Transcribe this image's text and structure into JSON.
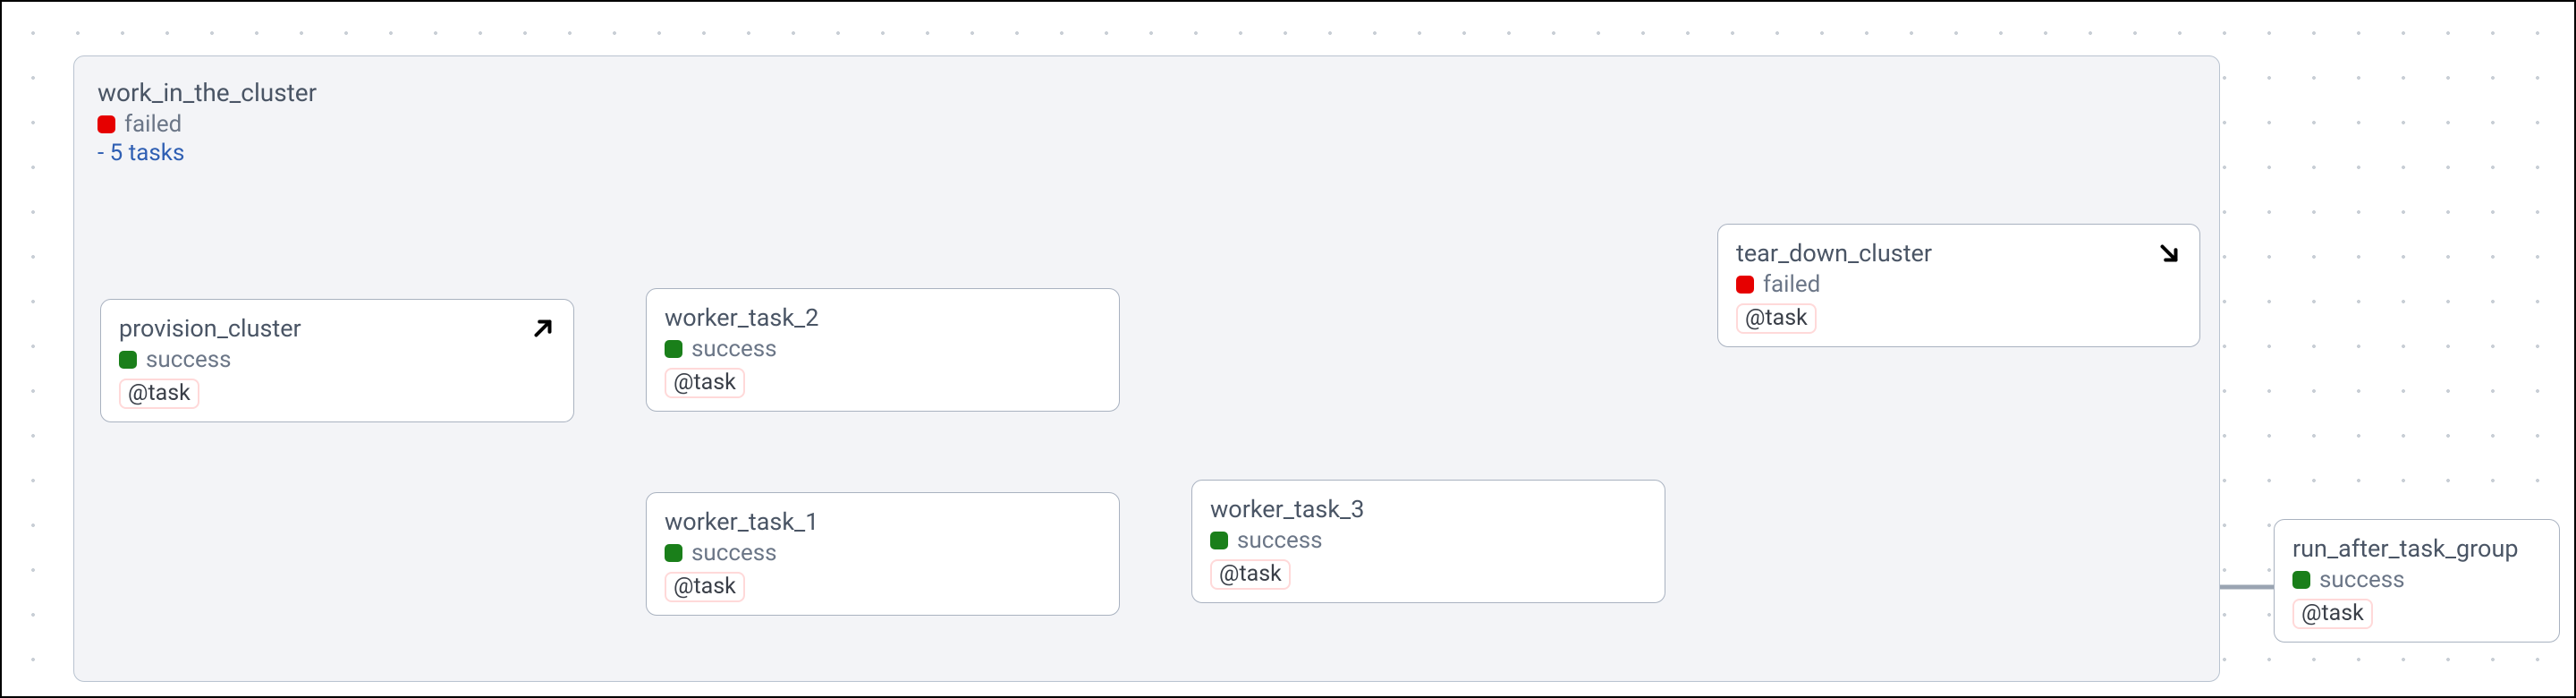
{
  "group": {
    "title": "work_in_the_cluster",
    "status": "failed",
    "tasks_line": "- 5 tasks"
  },
  "nodes": {
    "provision": {
      "title": "provision_cluster",
      "status": "success",
      "tag": "@task",
      "icon": "arrow-up-right"
    },
    "w2": {
      "title": "worker_task_2",
      "status": "success",
      "tag": "@task"
    },
    "w1": {
      "title": "worker_task_1",
      "status": "success",
      "tag": "@task"
    },
    "w3": {
      "title": "worker_task_3",
      "status": "success",
      "tag": "@task"
    },
    "teardown": {
      "title": "tear_down_cluster",
      "status": "failed",
      "tag": "@task",
      "icon": "arrow-down-right"
    },
    "after": {
      "title": "run_after_task_group",
      "status": "success",
      "tag": "@task"
    }
  },
  "colors": {
    "success": "#1a7f1a",
    "failed": "#e60000"
  }
}
